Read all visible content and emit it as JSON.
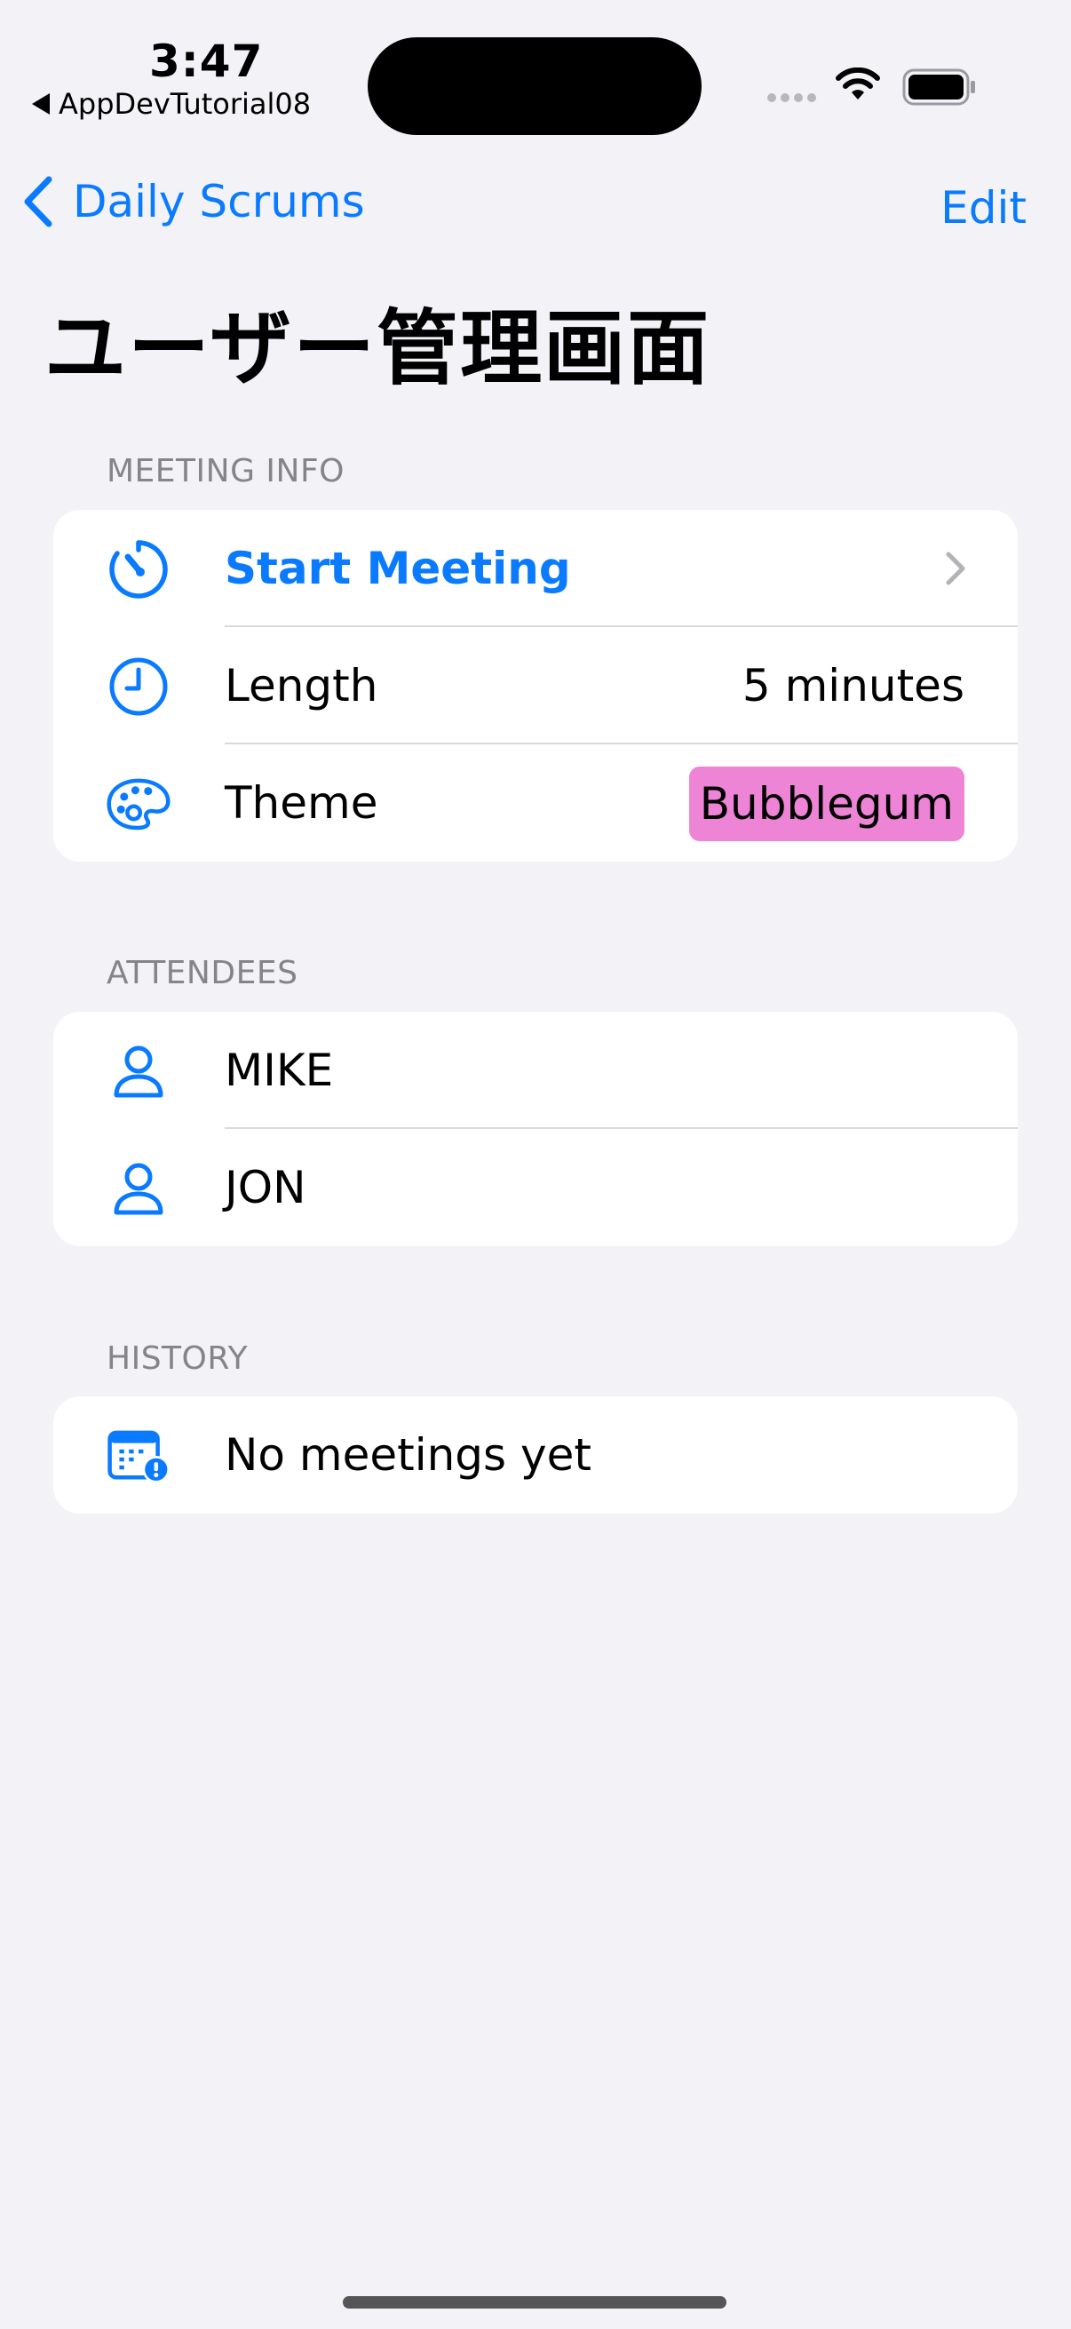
{
  "status_bar": {
    "time": "3:47",
    "back_app": "AppDevTutorial08"
  },
  "nav": {
    "back_label": "Daily Scrums",
    "edit_label": "Edit"
  },
  "page": {
    "title": "ユーザー管理画面"
  },
  "meeting_info": {
    "header": "MEETING INFO",
    "start_meeting": {
      "label": "Start Meeting",
      "icon": "timer-icon"
    },
    "length": {
      "label": "Length",
      "value": "5 minutes",
      "icon": "clock-icon"
    },
    "theme": {
      "label": "Theme",
      "value": "Bubblegum",
      "icon": "palette-icon",
      "color": "#ed84d6"
    }
  },
  "attendees": {
    "header": "ATTENDEES",
    "items": [
      {
        "name": "MIKE",
        "icon": "person-icon"
      },
      {
        "name": "JON",
        "icon": "person-icon"
      }
    ]
  },
  "history": {
    "header": "HISTORY",
    "empty_label": "No meetings yet",
    "icon": "calendar-exclamation-icon"
  },
  "colors": {
    "accent": "#0a7aff",
    "background": "#f2f2f7"
  }
}
